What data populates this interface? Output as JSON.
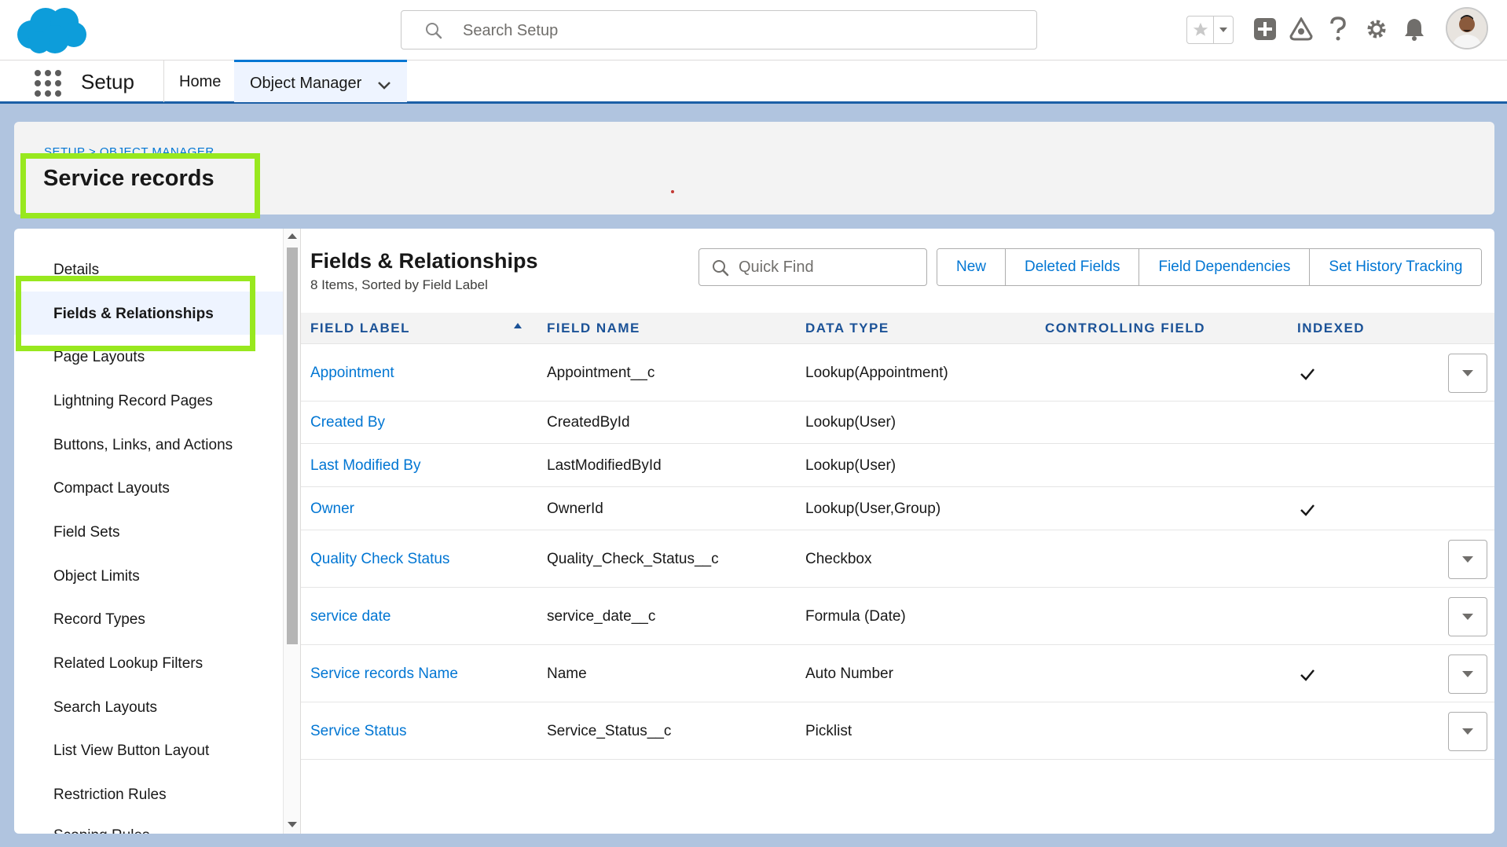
{
  "header": {
    "search_placeholder": "Search Setup"
  },
  "context_bar": {
    "app_name": "Setup",
    "tabs": [
      "Home",
      "Object Manager"
    ]
  },
  "page_header": {
    "breadcrumb": "SETUP > OBJECT MANAGER",
    "title": "Service records"
  },
  "left_nav": {
    "items": [
      "Details",
      "Fields & Relationships",
      "Page Layouts",
      "Lightning Record Pages",
      "Buttons, Links, and Actions",
      "Compact Layouts",
      "Field Sets",
      "Object Limits",
      "Record Types",
      "Related Lookup Filters",
      "Search Layouts",
      "List View Button Layout",
      "Restriction Rules",
      "Scoping Rules"
    ],
    "active": "Fields & Relationships"
  },
  "main": {
    "title": "Fields & Relationships",
    "subtitle": "8 Items, Sorted by Field Label",
    "quick_find_placeholder": "Quick Find",
    "buttons": [
      "New",
      "Deleted Fields",
      "Field Dependencies",
      "Set History Tracking"
    ],
    "columns": [
      "FIELD LABEL",
      "FIELD NAME",
      "DATA TYPE",
      "CONTROLLING FIELD",
      "INDEXED"
    ],
    "rows": [
      {
        "label": "Appointment",
        "name": "Appointment__c",
        "type": "Lookup(Appointment)",
        "controlling": "",
        "indexed": true,
        "action": true
      },
      {
        "label": "Created By",
        "name": "CreatedById",
        "type": "Lookup(User)",
        "controlling": "",
        "indexed": false,
        "action": false
      },
      {
        "label": "Last Modified By",
        "name": "LastModifiedById",
        "type": "Lookup(User)",
        "controlling": "",
        "indexed": false,
        "action": false
      },
      {
        "label": "Owner",
        "name": "OwnerId",
        "type": "Lookup(User,Group)",
        "controlling": "",
        "indexed": true,
        "action": false
      },
      {
        "label": "Quality Check Status",
        "name": "Quality_Check_Status__c",
        "type": "Checkbox",
        "controlling": "",
        "indexed": false,
        "action": true
      },
      {
        "label": "service date",
        "name": "service_date__c",
        "type": "Formula (Date)",
        "controlling": "",
        "indexed": false,
        "action": true
      },
      {
        "label": "Service records Name",
        "name": "Name",
        "type": "Auto Number",
        "controlling": "",
        "indexed": true,
        "action": true
      },
      {
        "label": "Service Status",
        "name": "Service_Status__c",
        "type": "Picklist",
        "controlling": "",
        "indexed": false,
        "action": true
      }
    ]
  },
  "colors": {
    "brand": "#0176d3",
    "highlight": "#98e81e",
    "header_text": "#1b5297"
  }
}
